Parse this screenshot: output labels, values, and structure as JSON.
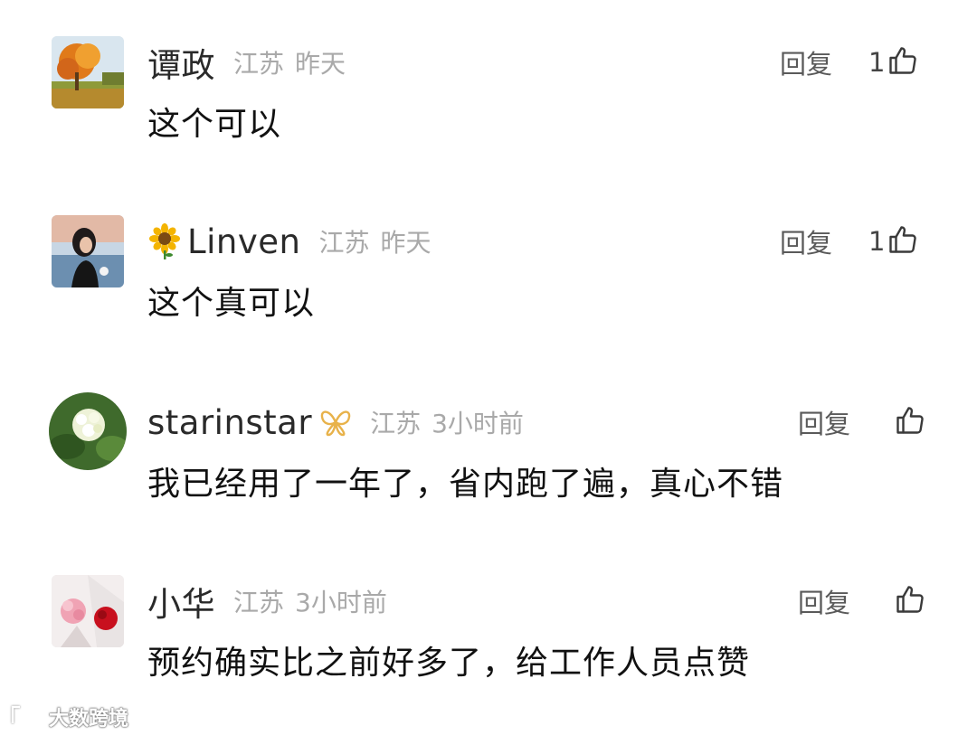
{
  "comments": [
    {
      "username": "谭政",
      "location": "江苏",
      "time": "昨天",
      "reply_label": "回复",
      "like_count": "1",
      "text": "这个可以"
    },
    {
      "username": "Linven",
      "badge_icon": "sunflower-icon",
      "location": "江苏",
      "time": "昨天",
      "reply_label": "回复",
      "like_count": "1",
      "text": "这个真可以"
    },
    {
      "username": "starinstar",
      "vip_icon": "butterfly-vip-icon",
      "location": "江苏",
      "time": "3小时前",
      "reply_label": "回复",
      "like_count": "",
      "text": "我已经用了一年了，省内跑了遍，真心不错"
    },
    {
      "username": "小华",
      "location": "江苏",
      "time": "3小时前",
      "reply_label": "回复",
      "like_count": "",
      "text": "预约确实比之前好多了，给工作人员点赞"
    }
  ],
  "watermark": {
    "text": "大数跨境",
    "icon": "watermark-logo-icon"
  },
  "colors": {
    "meta_gray": "#a9a9a9",
    "reply_gray": "#5a5a5a",
    "vip_gold": "#e8b24a"
  }
}
